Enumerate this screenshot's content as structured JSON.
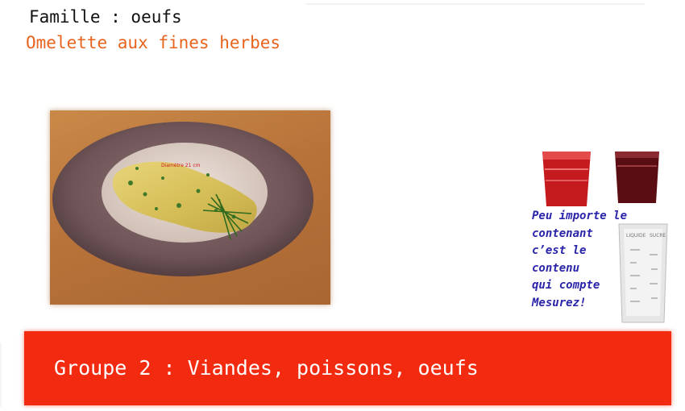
{
  "header": {
    "family_label": "Famille : oeufs",
    "recipe_title": "Omelette aux fines herbes"
  },
  "photo": {
    "plate_caption": "Diamètre 21 cm"
  },
  "side": {
    "measure_text": "Peu importe le\ncontenant\nc’est le\ncontenu\nqui compte\nMesurez!",
    "cup_labels": [
      "LIQUIDE",
      "SUCRE"
    ]
  },
  "banner": {
    "group_label": "Groupe 2 : Viandes, poissons, oeufs"
  },
  "colors": {
    "recipe_title": "#e8641e",
    "banner": "#f22a10",
    "measure_text": "#2a24a8"
  }
}
